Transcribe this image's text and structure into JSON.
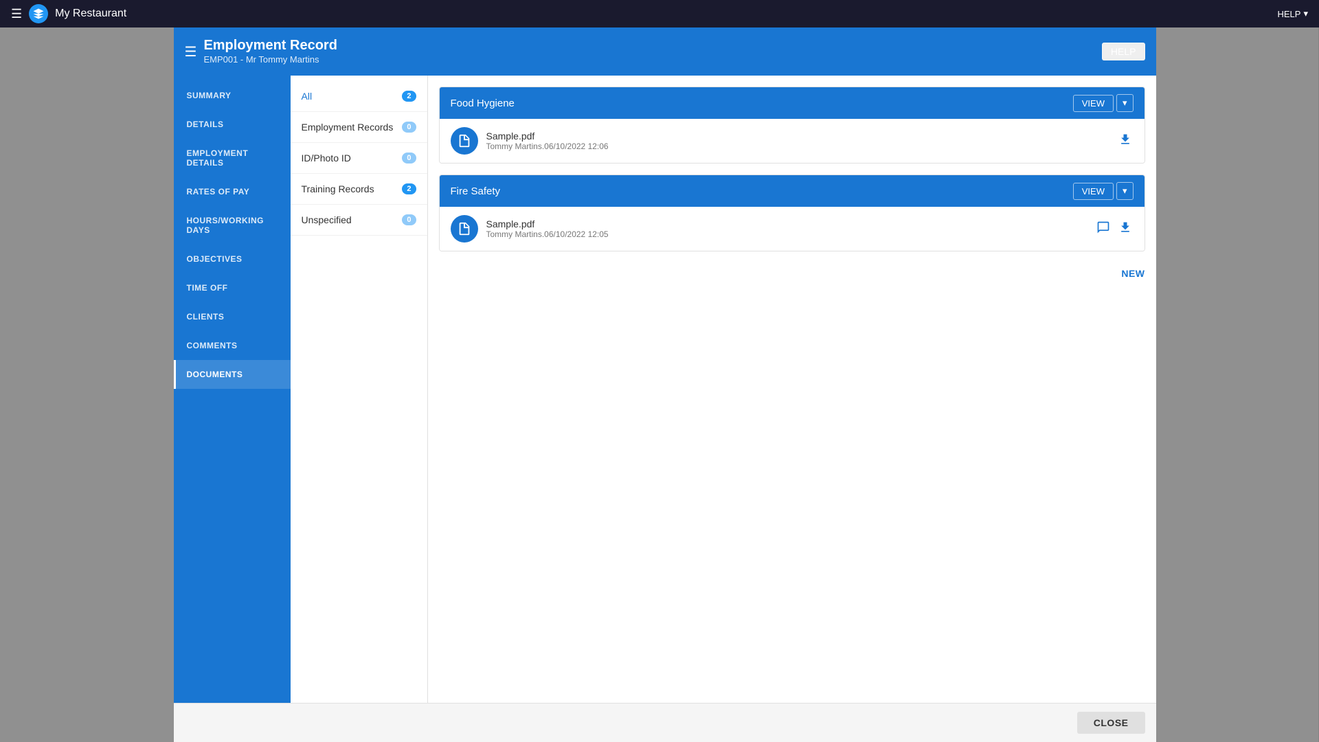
{
  "topNav": {
    "title": "My Restaurant",
    "helpLabel": "HELP",
    "menuIcon": "hamburger-icon"
  },
  "modalHeader": {
    "title": "Employment Record",
    "subtitle": "EMP001 - Mr Tommy Martins",
    "helpLabel": "HELP"
  },
  "sidebar": {
    "items": [
      {
        "id": "summary",
        "label": "SUMMARY",
        "active": false
      },
      {
        "id": "details",
        "label": "DETAILS",
        "active": false
      },
      {
        "id": "employment-details",
        "label": "EMPLOYMENT DETAILS",
        "active": false
      },
      {
        "id": "rates-of-pay",
        "label": "RATES OF PAY",
        "active": false
      },
      {
        "id": "hours-working-days",
        "label": "HOURS/WORKING DAYS",
        "active": false
      },
      {
        "id": "objectives",
        "label": "OBJECTIVES",
        "active": false
      },
      {
        "id": "time-off",
        "label": "TIME OFF",
        "active": false
      },
      {
        "id": "clients",
        "label": "CLIENTS",
        "active": false
      },
      {
        "id": "comments",
        "label": "COMMENTS",
        "active": false
      },
      {
        "id": "documents",
        "label": "DOCUMENTS",
        "active": true
      }
    ]
  },
  "subNav": {
    "items": [
      {
        "id": "all",
        "label": "All",
        "count": 2,
        "active": true
      },
      {
        "id": "employment-records",
        "label": "Employment Records",
        "count": 0,
        "active": false
      },
      {
        "id": "id-photo-id",
        "label": "ID/Photo ID",
        "count": 0,
        "active": false
      },
      {
        "id": "training-records",
        "label": "Training Records",
        "count": 2,
        "active": false
      },
      {
        "id": "unspecified",
        "label": "Unspecified",
        "count": 0,
        "active": false
      }
    ]
  },
  "categories": [
    {
      "id": "food-hygiene",
      "title": "Food Hygiene",
      "viewLabel": "VIEW",
      "dropdownIcon": "chevron-down-icon",
      "documents": [
        {
          "id": "doc1",
          "name": "Sample.pdf",
          "meta": "Tommy Martins.06/10/2022 12:06",
          "hasComment": false,
          "hasDownload": true
        }
      ]
    },
    {
      "id": "fire-safety",
      "title": "Fire Safety",
      "viewLabel": "VIEW",
      "dropdownIcon": "chevron-down-icon",
      "documents": [
        {
          "id": "doc2",
          "name": "Sample.pdf",
          "meta": "Tommy Martins.06/10/2022 12:05",
          "hasComment": true,
          "hasDownload": true
        }
      ]
    }
  ],
  "newButtonLabel": "NEW",
  "closeButtonLabel": "CLOSE"
}
